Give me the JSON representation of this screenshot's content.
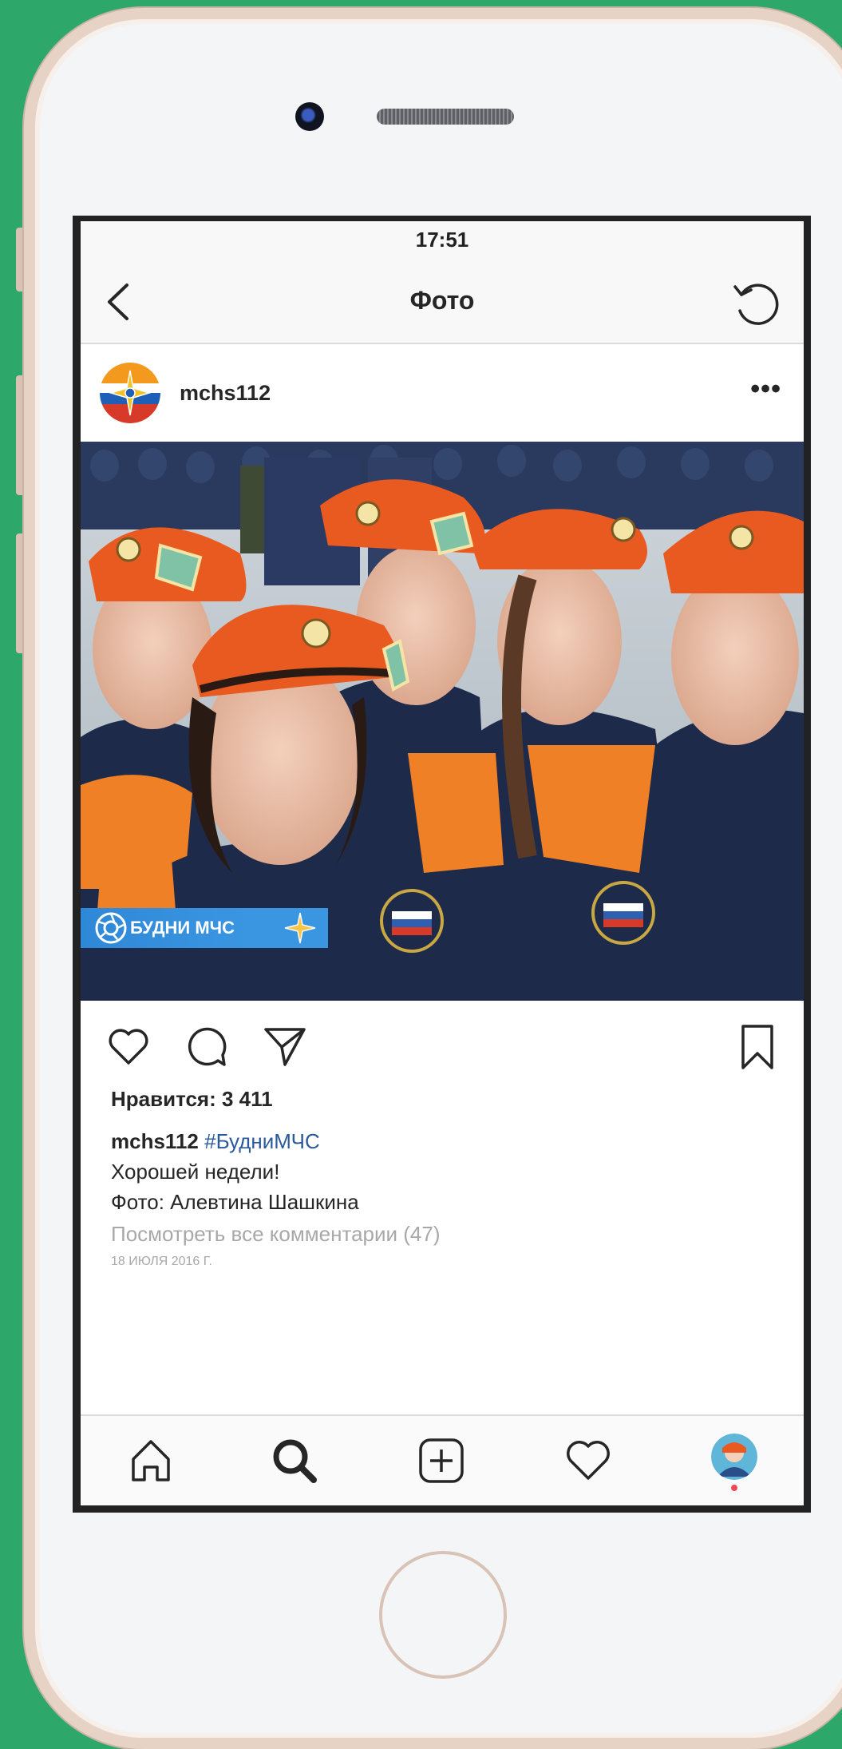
{
  "status_bar": {
    "time": "17:51"
  },
  "nav": {
    "title": "Фото"
  },
  "post": {
    "username": "mchs112",
    "watermark": "БУДНИ МЧС",
    "likes": "Нравится: 3 411",
    "caption_user": "mchs112",
    "hashtag": "#БудниМЧС",
    "caption_line1": "Хорошей недели!",
    "caption_line2": "Фото: Алевтина Шашкина",
    "comments_link": "Посмотреть все комментарии (47)",
    "date": "18 июля 2016 г."
  },
  "colors": {
    "background": "#2ea86a",
    "beret": "#e85a20",
    "uniform_dark": "#1d2a4a",
    "uniform_orange": "#f08025",
    "hashtag": "#2b5a9a",
    "notification_dot": "#ed4956"
  },
  "icons": {
    "back": "chevron-left-icon",
    "refresh": "refresh-icon",
    "more": "more-icon",
    "like": "heart-icon",
    "comment": "comment-icon",
    "share": "send-icon",
    "save": "bookmark-icon",
    "home": "home-icon",
    "search": "search-icon",
    "add": "add-post-icon",
    "activity": "heart-icon",
    "profile": "profile-avatar"
  }
}
